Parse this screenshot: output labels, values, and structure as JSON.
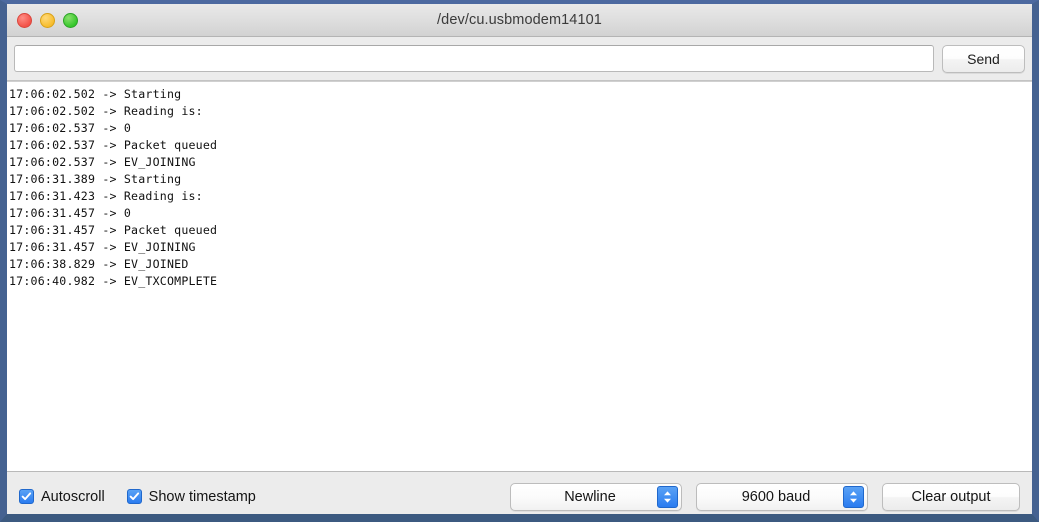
{
  "window": {
    "title": "/dev/cu.usbmodem14101",
    "traffic_lights": [
      {
        "name": "close",
        "color": "#f35349"
      },
      {
        "name": "minimize",
        "color": "#f7bd2e"
      },
      {
        "name": "maximize",
        "color": "#36c72c"
      }
    ],
    "frame_color": "#456291"
  },
  "send_bar": {
    "input_value": "",
    "input_placeholder": "",
    "send_label": "Send"
  },
  "console": {
    "lines": [
      "17:06:02.502 -> Starting",
      "17:06:02.502 -> Reading is:",
      "17:06:02.537 -> 0",
      "17:06:02.537 -> Packet queued",
      "17:06:02.537 -> EV_JOINING",
      "17:06:31.389 -> Starting",
      "17:06:31.423 -> Reading is:",
      "17:06:31.457 -> 0",
      "17:06:31.457 -> Packet queued",
      "17:06:31.457 -> EV_JOINING",
      "17:06:38.829 -> EV_JOINED",
      "17:06:40.982 -> EV_TXCOMPLETE"
    ]
  },
  "bottom_bar": {
    "autoscroll": {
      "label": "Autoscroll",
      "checked": true
    },
    "show_timestamp": {
      "label": "Show timestamp",
      "checked": true
    },
    "line_ending": {
      "selected": "Newline"
    },
    "baud_rate": {
      "selected": "9600 baud"
    },
    "clear_label": "Clear output",
    "accent_color": "#2a7bf0"
  }
}
